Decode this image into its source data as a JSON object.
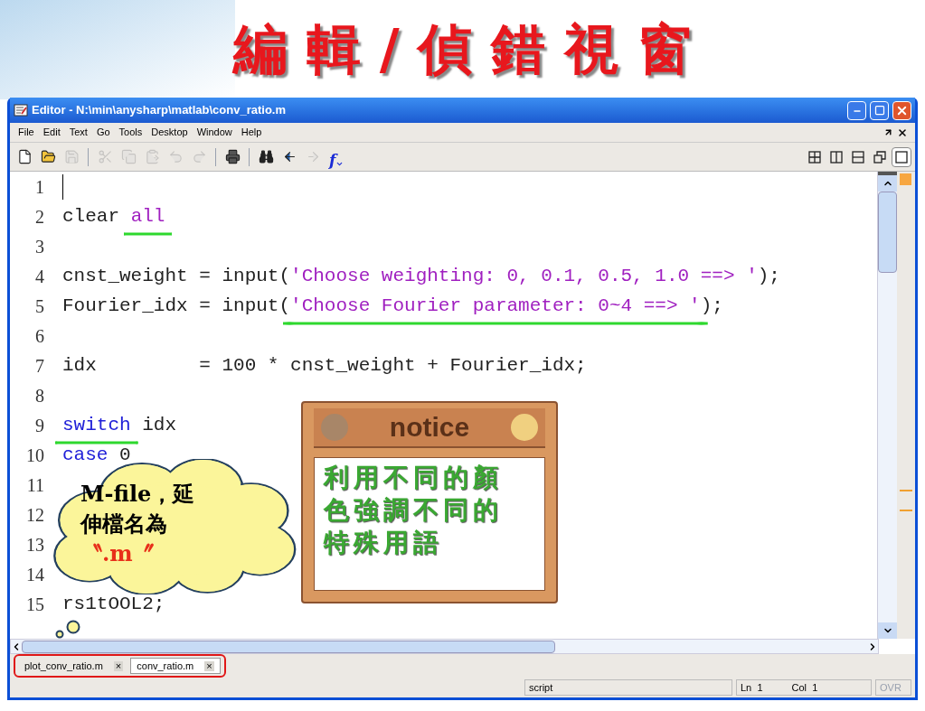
{
  "slide_title": "編 輯 / 偵 錯 視 窗",
  "window": {
    "title": "Editor - N:\\min\\anysharp\\matlab\\conv_ratio.m"
  },
  "menu": [
    "File",
    "Edit",
    "Text",
    "Go",
    "Tools",
    "Desktop",
    "Window",
    "Help"
  ],
  "toolbar": [
    {
      "kind": "new",
      "disabled": false
    },
    {
      "kind": "open",
      "disabled": false
    },
    {
      "kind": "save",
      "disabled": true
    },
    {
      "kind": "separator"
    },
    {
      "kind": "cut",
      "disabled": true
    },
    {
      "kind": "copy",
      "disabled": true
    },
    {
      "kind": "paste",
      "disabled": true
    },
    {
      "kind": "undo",
      "disabled": true
    },
    {
      "kind": "redo",
      "disabled": true
    },
    {
      "kind": "separator"
    },
    {
      "kind": "print",
      "disabled": false
    },
    {
      "kind": "separator"
    },
    {
      "kind": "find",
      "disabled": false
    },
    {
      "kind": "back",
      "disabled": false
    },
    {
      "kind": "forward",
      "disabled": true
    },
    {
      "kind": "function",
      "disabled": false,
      "label": "f"
    }
  ],
  "layout_buttons": [
    {
      "kind": "tile",
      "selected": false
    },
    {
      "kind": "left_right",
      "selected": false
    },
    {
      "kind": "top_bottom",
      "selected": false
    },
    {
      "kind": "float",
      "selected": false
    },
    {
      "kind": "maximize",
      "selected": true
    }
  ],
  "code_lines": [
    {
      "number": "1",
      "cursor": true
    },
    {
      "number": "2",
      "segments": [
        {
          "text": "clear ",
          "kind": "plain"
        },
        {
          "text": "all",
          "kind": "string",
          "underlined": true
        }
      ]
    },
    {
      "number": "3"
    },
    {
      "number": "4",
      "segments": [
        {
          "text": "cnst_weight = input(",
          "kind": "plain"
        },
        {
          "text": "'Choose weighting: 0, 0.1, 0.5, 1.0 ==> '",
          "kind": "string"
        },
        {
          "text": ");",
          "kind": "plain"
        }
      ]
    },
    {
      "number": "5",
      "segments": [
        {
          "text": "Fourier_idx = input(",
          "kind": "plain"
        },
        {
          "text": "'Choose Fourier parameter: 0~4 ==> '",
          "kind": "string",
          "underlined": true
        },
        {
          "text": ");",
          "kind": "plain"
        }
      ]
    },
    {
      "number": "6"
    },
    {
      "number": "7",
      "segments": [
        {
          "text": "idx         = 100 * cnst_weight + Fourier_idx;",
          "kind": "plain"
        }
      ]
    },
    {
      "number": "8"
    },
    {
      "number": "9",
      "segments": [
        {
          "text": "switch",
          "kind": "keyword",
          "underlined": true
        },
        {
          "text": " idx",
          "kind": "plain"
        }
      ]
    },
    {
      "number": "10",
      "segments": [
        {
          "text": "case",
          "kind": "keyword"
        },
        {
          "text": " 0",
          "kind": "plain"
        }
      ]
    },
    {
      "number": "11"
    },
    {
      "number": "12"
    },
    {
      "number": "13"
    },
    {
      "number": "14"
    },
    {
      "number": "15",
      "segments": [
        {
          "text": "rs1tOOL2;",
          "kind": "plain"
        }
      ]
    }
  ],
  "cloud": {
    "text": "M-file，延伸檔名為",
    "extension": "〝.m〞"
  },
  "notice": {
    "title": "notice",
    "text": "利用不同的顏色強調不同的特殊用語"
  },
  "tabs": [
    {
      "label": "plot_conv_ratio.m",
      "selected": false,
      "close": "×"
    },
    {
      "label": "conv_ratio.m",
      "selected": true,
      "close": "×"
    }
  ],
  "status_bar": {
    "mode": "script",
    "line_label": "Ln",
    "line": "1",
    "col_label": "Col",
    "col": "1",
    "ovr": {
      "label": "OVR",
      "disabled": true
    }
  }
}
